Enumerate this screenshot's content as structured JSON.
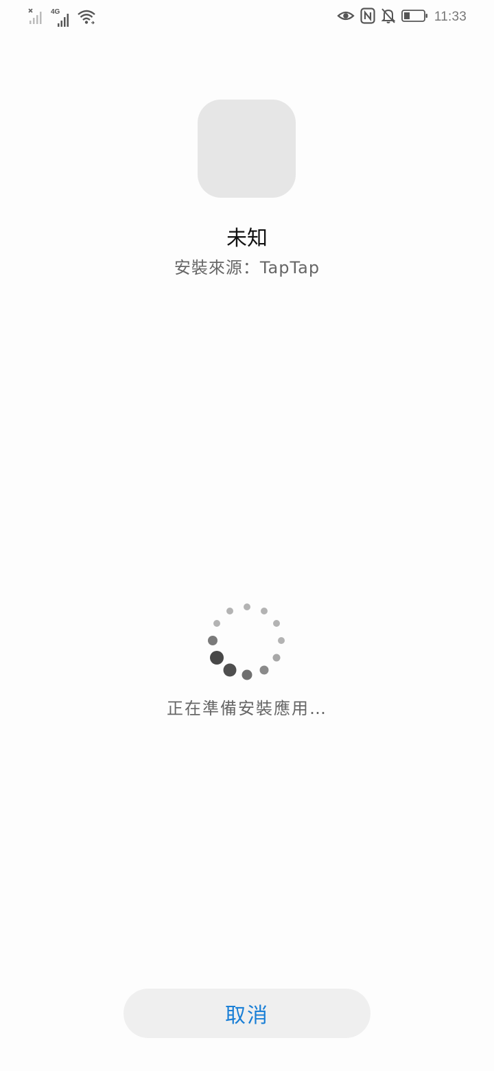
{
  "status_bar": {
    "time": "11:33",
    "icons": {
      "left": [
        "no-signal-sim-icon",
        "4g-signal-icon",
        "wifi-icon"
      ],
      "right": [
        "eye-comfort-icon",
        "nfc-icon",
        "mute-bell-icon",
        "battery-icon"
      ]
    },
    "network_label": "4G",
    "battery_level": 0.3
  },
  "app": {
    "name": "未知",
    "source": "安裝來源：TapTap"
  },
  "loading": {
    "text": "正在準備安裝應用…"
  },
  "actions": {
    "cancel_label": "取消"
  },
  "colors": {
    "accent": "#1a7fd6",
    "background": "#fdfdfd",
    "button_bg": "#efefef",
    "icon_placeholder": "#e6e6e6"
  }
}
